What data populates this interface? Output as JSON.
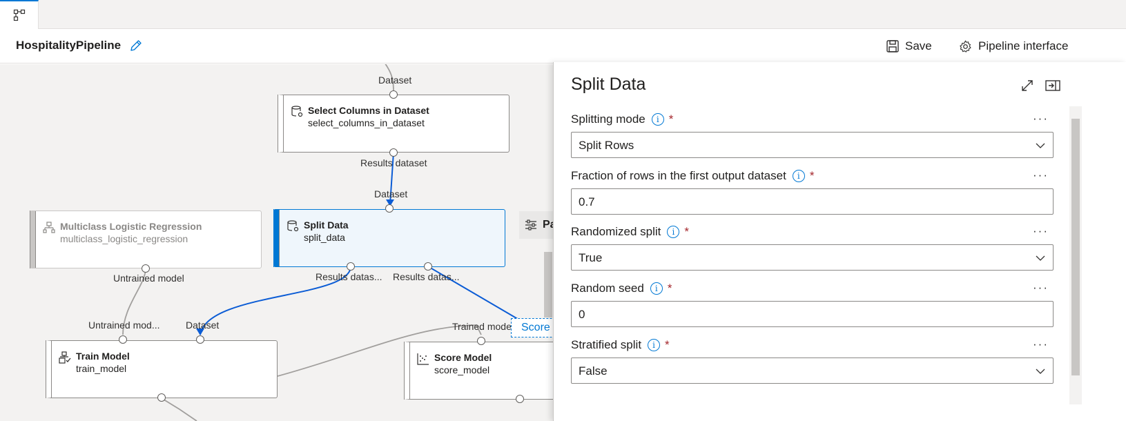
{
  "tabbar": {
    "tab_icon": "pipeline-icon"
  },
  "toolbar": {
    "title": "HospitalityPipeline",
    "edit_icon": "pencil-icon",
    "save_label": "Save",
    "pipeline_interface_label": "Pipeline interface"
  },
  "canvas": {
    "nodes": {
      "select_columns": {
        "title": "Select Columns in Dataset",
        "subtitle": "select_columns_in_dataset",
        "in_label": "Dataset",
        "out_label": "Results dataset"
      },
      "split_data": {
        "title": "Split Data",
        "subtitle": "split_data",
        "in_label": "Dataset",
        "out1_label": "Results datas...",
        "out2_label": "Results datas..."
      },
      "multiclass": {
        "title": "Multiclass Logistic Regression",
        "subtitle": "multiclass_logistic_regression",
        "out_label": "Untrained model"
      },
      "train_model": {
        "title": "Train Model",
        "subtitle": "train_model",
        "in1_label": "Untrained mod...",
        "in2_label": "Dataset"
      },
      "score_model": {
        "title": "Score Model",
        "subtitle": "score_model",
        "in1_label": "Trained model"
      }
    },
    "params_chip_label": "Pa",
    "score_tag_label": "Score D"
  },
  "panel": {
    "title": "Split Data",
    "fields": [
      {
        "label": "Splitting mode",
        "value": "Split Rows",
        "type": "dropdown"
      },
      {
        "label": "Fraction of rows in the first output dataset",
        "value": "0.7",
        "type": "text"
      },
      {
        "label": "Randomized split",
        "value": "True",
        "type": "dropdown"
      },
      {
        "label": "Random seed",
        "value": "0",
        "type": "text"
      },
      {
        "label": "Stratified split",
        "value": "False",
        "type": "dropdown"
      }
    ],
    "required_mark": "*",
    "more_label": "···"
  },
  "colors": {
    "accent": "#0078d4",
    "required": "#a4262c",
    "canvas_bg": "#f3f2f1"
  }
}
